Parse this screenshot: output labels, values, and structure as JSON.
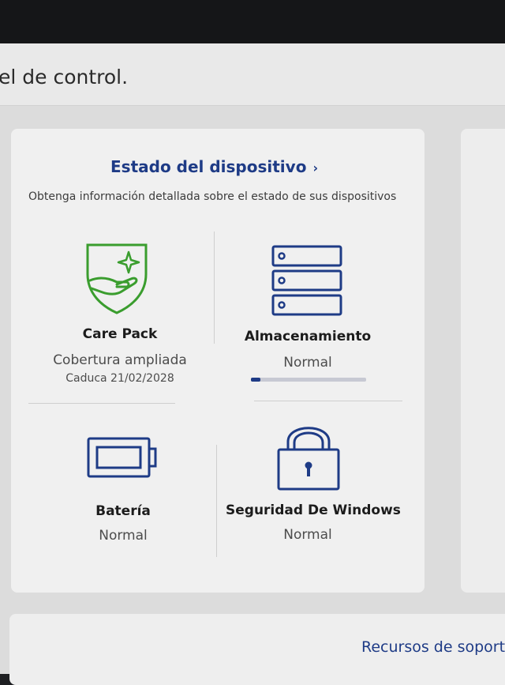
{
  "header": {
    "title": "el de control."
  },
  "device_status": {
    "heading": "Estado del dispositivo",
    "chevron": "›",
    "description": "Obtenga información detallada sobre el estado de sus dispositivos",
    "tiles": {
      "care_pack": {
        "title": "Care Pack",
        "status": "Cobertura ampliada",
        "expiry": "Caduca 21/02/2028",
        "icon": "shield-hand-sparkle-icon"
      },
      "storage": {
        "title": "Almacenamiento",
        "status": "Normal",
        "usage_fraction": 0.08,
        "icon": "server-stack-icon"
      },
      "battery": {
        "title": "Batería",
        "status": "Normal",
        "icon": "battery-icon"
      },
      "windows_security": {
        "title": "Seguridad De Windows",
        "status": "Normal",
        "icon": "padlock-icon"
      }
    }
  },
  "support": {
    "link_label": "Recursos de soport"
  },
  "colors": {
    "accent": "#1e3b86",
    "care_pack_green": "#3a9d2e"
  }
}
